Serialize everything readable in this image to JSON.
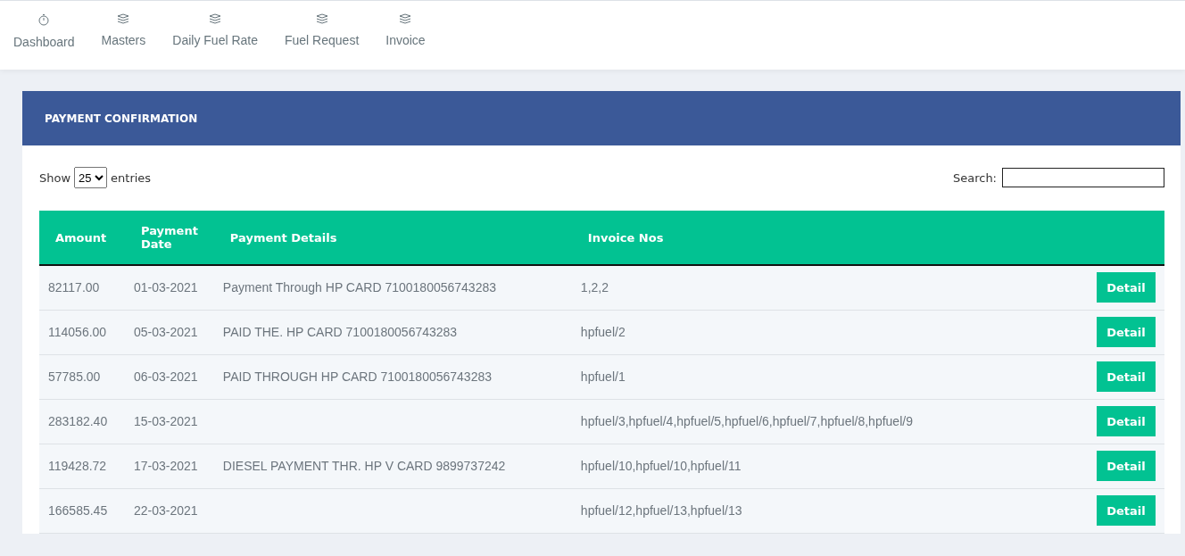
{
  "nav": [
    {
      "label": "Dashboard",
      "kind": "home"
    },
    {
      "label": "Masters",
      "kind": "module"
    },
    {
      "label": "Daily Fuel Rate",
      "kind": "module"
    },
    {
      "label": "Fuel Request",
      "kind": "module"
    },
    {
      "label": "Invoice",
      "kind": "module"
    }
  ],
  "panel": {
    "title": "PAYMENT CONFIRMATION"
  },
  "length": {
    "before": "Show",
    "value": "25",
    "after": "entries"
  },
  "search": {
    "label": "Search:"
  },
  "table": {
    "columns": [
      "Amount",
      "Payment Date",
      "Payment Details",
      "Invoice Nos"
    ],
    "rows": [
      {
        "cells": [
          "82117.00",
          "01-03-2021",
          "Payment Through HP CARD 7100180056743283",
          "1,2,2"
        ],
        "action": "Detail"
      },
      {
        "cells": [
          "114056.00",
          "05-03-2021",
          "PAID THE. HP CARD 7100180056743283",
          "hpfuel/2"
        ],
        "action": "Detail"
      },
      {
        "cells": [
          "57785.00",
          "06-03-2021",
          "PAID THROUGH HP CARD 7100180056743283",
          "hpfuel/1"
        ],
        "action": "Detail"
      },
      {
        "cells": [
          "283182.40",
          "15-03-2021",
          "",
          "hpfuel/3,hpfuel/4,hpfuel/5,hpfuel/6,hpfuel/7,hpfuel/8,hpfuel/9"
        ],
        "action": "Detail"
      },
      {
        "cells": [
          "119428.72",
          "17-03-2021",
          "DIESEL PAYMENT THR. HP V CARD 9899737242",
          "hpfuel/10,hpfuel/10,hpfuel/11"
        ],
        "action": "Detail"
      },
      {
        "cells": [
          "166585.45",
          "22-03-2021",
          "",
          "hpfuel/12,hpfuel/13,hpfuel/13"
        ],
        "action": "Detail"
      }
    ]
  }
}
